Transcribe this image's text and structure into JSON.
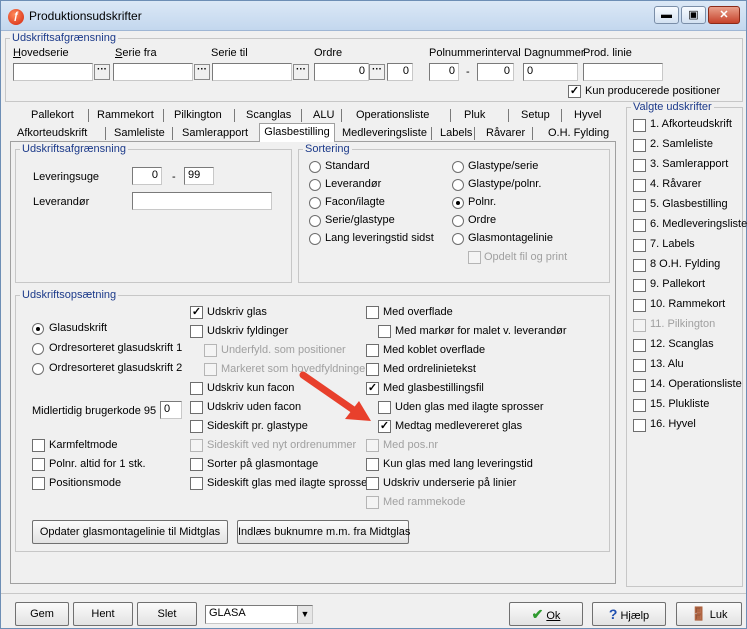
{
  "window": {
    "title": "Produktionsudskrifter"
  },
  "top_group": {
    "legend": "Udskriftsafgrænsning",
    "hovedserie_label": "Hovedserie",
    "serie_fra_label": "Serie fra",
    "serie_til_label": "Serie til",
    "ordre_label": "Ordre",
    "ordre_from": "0",
    "ordre_to": "0",
    "polnr_label": "Polnummerinterval",
    "polnr_from": "0",
    "polnr_dash": "-",
    "polnr_to": "0",
    "dagnummer_label": "Dagnummer",
    "dagnummer_value": "0",
    "prodlinie_label": "Prod. linie",
    "prodlinie_value": "",
    "kun_producerede_label": "Kun producerede positioner"
  },
  "tabs_row1": [
    "Pallekort",
    "Rammekort",
    "Pilkington",
    "Scanglas",
    "ALU",
    "Operationsliste",
    "Pluk",
    "Setup",
    "Hyvel"
  ],
  "tabs_row2": [
    "Afkorteudskrift",
    "Samleliste",
    "Samlerapport",
    "Glasbestilling",
    "Medleveringsliste",
    "Labels",
    "Råvarer",
    "O.H. Fylding"
  ],
  "panel": {
    "afgr_legend": "Udskriftsafgrænsning",
    "leveringsuge_label": "Leveringsuge",
    "leveringsuge_from": "0",
    "leveringsuge_dash": "-",
    "leveringsuge_to": "99",
    "leverandor_label": "Leverandør",
    "leverandor_value": "",
    "sortering_legend": "Sortering",
    "sort_left": [
      "Standard",
      "Leverandør",
      "Facon/ilagte",
      "Serie/glastype",
      "Lang leveringstid sidst"
    ],
    "sort_right": [
      "Glastype/serie",
      "Glastype/polnr.",
      "Polnr.",
      "Ordre",
      "Glasmontagelinie"
    ],
    "opdelt_label": "Opdelt fil og print",
    "ops_legend": "Udskriftsopsætning",
    "radio_glas": [
      "Glasudskrift",
      "Ordresorteret glasudskrift 1",
      "Ordresorteret glasudskrift 2"
    ],
    "midlertidig_label": "Midlertidig brugerkode 95",
    "midlertidig_value": "0",
    "left_checks": [
      "Karmfeltmode",
      "Polnr. altid for 1 stk.",
      "Positionsmode"
    ],
    "mid_checks": [
      "Udskriv glas",
      "Udskriv fyldinger",
      "Underfyld. som positioner",
      "Markeret som hovedfyldninger",
      "Udskriv kun facon",
      "Udskriv uden facon",
      "Sideskift pr. glastype",
      "Sideskift ved nyt ordrenummer",
      "Sorter på glasmontage",
      "Sideskift glas med ilagte sprosser"
    ],
    "right_checks": [
      "Med overflade",
      "Med markør for malet v. leverandør",
      "Med koblet overflade",
      "Med ordrelinietekst",
      "Med glasbestillingsfil",
      "Uden glas med ilagte sprosser",
      "Medtag medlevereret glas",
      "Med pos.nr",
      "Kun glas med lang leveringstid",
      "Udskriv underserie på linier",
      "Med rammekode"
    ],
    "btn_opdater": "Opdater glasmontagelinie til Midtglas",
    "btn_indlaes": "Indlæs buknumre m.m. fra Midtglas"
  },
  "valgte": {
    "legend": "Valgte udskrifter",
    "items": [
      "1. Afkorteudskrift",
      "2. Samleliste",
      "3. Samlerapport",
      "4. Råvarer",
      "5. Glasbestilling",
      "6. Medleveringsliste",
      "7. Labels",
      "8 O.H. Fylding",
      "9. Pallekort",
      "10. Rammekort",
      "11. Pilkington",
      "12. Scanglas",
      "13. Alu",
      "14. Operationsliste",
      "15. Plukliste",
      "16. Hyvel"
    ]
  },
  "bottom": {
    "gem": "Gem",
    "hent": "Hent",
    "slet": "Slet",
    "combo_value": "GLASA",
    "ok": "Ok",
    "hjaelp": "Hjælp",
    "luk": "Luk"
  },
  "colors": {
    "accent_red": "#e8402c",
    "legend_blue": "#1c3a8a"
  }
}
